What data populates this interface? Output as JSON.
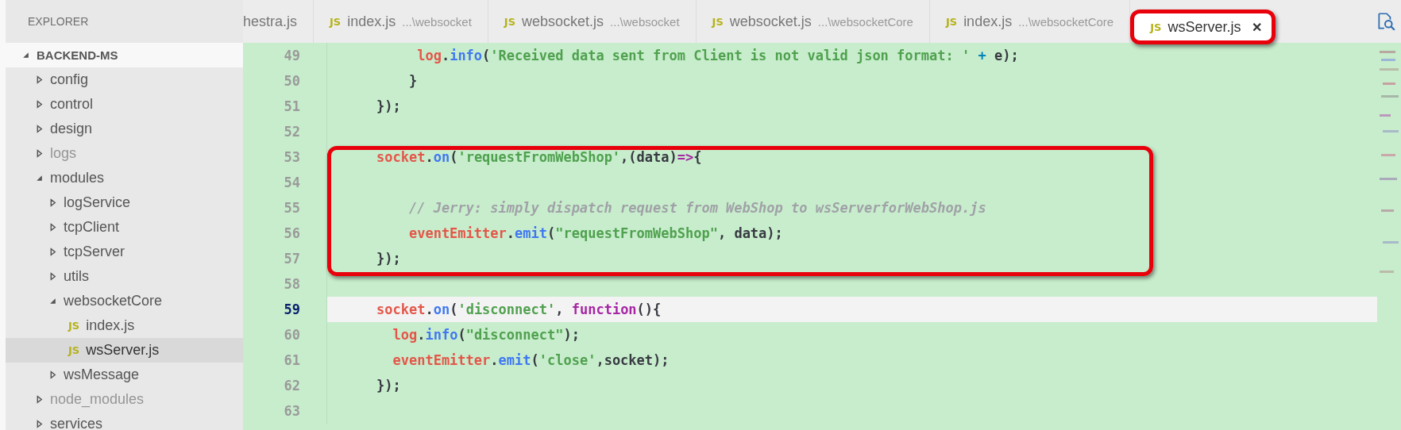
{
  "sidebar": {
    "title": "EXPLORER",
    "tree": [
      {
        "label": "BACKEND-MS",
        "kind": "root",
        "expanded": true,
        "children": [
          {
            "label": "config",
            "kind": "folder",
            "expanded": false,
            "dimmed": false
          },
          {
            "label": "control",
            "kind": "folder",
            "expanded": false,
            "dimmed": false
          },
          {
            "label": "design",
            "kind": "folder",
            "expanded": false,
            "dimmed": false
          },
          {
            "label": "logs",
            "kind": "folder",
            "expanded": false,
            "dimmed": true
          },
          {
            "label": "modules",
            "kind": "folder",
            "expanded": true,
            "dimmed": false,
            "children": [
              {
                "label": "logService",
                "kind": "folder",
                "expanded": false,
                "dimmed": false
              },
              {
                "label": "tcpClient",
                "kind": "folder",
                "expanded": false,
                "dimmed": false
              },
              {
                "label": "tcpServer",
                "kind": "folder",
                "expanded": false,
                "dimmed": false
              },
              {
                "label": "utils",
                "kind": "folder",
                "expanded": false,
                "dimmed": false
              },
              {
                "label": "websocketCore",
                "kind": "folder",
                "expanded": true,
                "dimmed": false,
                "children": [
                  {
                    "label": "index.js",
                    "kind": "file",
                    "badge": "JS",
                    "selected": false
                  },
                  {
                    "label": "wsServer.js",
                    "kind": "file",
                    "badge": "JS",
                    "selected": true
                  }
                ]
              },
              {
                "label": "wsMessage",
                "kind": "folder",
                "expanded": false,
                "dimmed": false
              }
            ]
          },
          {
            "label": "node_modules",
            "kind": "folder",
            "expanded": false,
            "dimmed": true
          },
          {
            "label": "services",
            "kind": "folder",
            "expanded": false,
            "dimmed": false
          }
        ]
      }
    ]
  },
  "tabs": [
    {
      "label": "hestra.js",
      "selected": false,
      "highlighted": false
    },
    {
      "badge": "JS",
      "label": "index.js",
      "path": "...\\websocket",
      "selected": false,
      "highlighted": false
    },
    {
      "badge": "JS",
      "label": "websocket.js",
      "path": "...\\websocket",
      "selected": false,
      "highlighted": false
    },
    {
      "badge": "JS",
      "label": "websocket.js",
      "path": "...\\websocketCore",
      "selected": false,
      "highlighted": false
    },
    {
      "badge": "JS",
      "label": "index.js",
      "path": "...\\websocketCore",
      "selected": false,
      "highlighted": false
    },
    {
      "badge": "JS",
      "label": "wsServer.js",
      "selected": true,
      "highlighted": true,
      "close": "✕"
    }
  ],
  "editor": {
    "blocks": [
      {
        "highlighted": false,
        "lines": [
          {
            "number": "49",
            "current": false,
            "tokens": [
              {
                "kind": "obj",
                "text": "     log"
              },
              {
                "kind": "plain",
                "text": "."
              },
              {
                "kind": "fn",
                "text": "info"
              },
              {
                "kind": "plain",
                "text": "("
              },
              {
                "kind": "str",
                "text": "'Received data sent from Client is not valid json format: '"
              },
              {
                "kind": "op",
                "text": " + "
              },
              {
                "kind": "plain",
                "text": "e);"
              }
            ]
          },
          {
            "number": "50",
            "current": false,
            "tokens": [
              {
                "kind": "plain",
                "text": "    }"
              }
            ]
          },
          {
            "number": "51",
            "current": false,
            "tokens": [
              {
                "kind": "plain",
                "text": "});"
              }
            ]
          },
          {
            "number": "52",
            "current": false
          }
        ]
      },
      {
        "highlighted": true,
        "lines": [
          {
            "number": "53",
            "current": false,
            "tokens": [
              {
                "kind": "obj",
                "text": "socket"
              },
              {
                "kind": "plain",
                "text": "."
              },
              {
                "kind": "fn",
                "text": "on"
              },
              {
                "kind": "plain",
                "text": "("
              },
              {
                "kind": "str",
                "text": "'requestFromWebShop'"
              },
              {
                "kind": "plain",
                "text": ",(data)"
              },
              {
                "kind": "kw",
                "text": "=>"
              },
              {
                "kind": "plain",
                "text": "{"
              }
            ]
          },
          {
            "number": "54",
            "current": false
          },
          {
            "number": "55",
            "current": false,
            "tokens": [
              {
                "kind": "comment",
                "text": "    // Jerry: simply dispatch request from WebShop to wsServerforWebShop.js"
              }
            ]
          },
          {
            "number": "56",
            "current": false,
            "tokens": [
              {
                "kind": "obj",
                "text": "    eventEmitter"
              },
              {
                "kind": "plain",
                "text": "."
              },
              {
                "kind": "fn",
                "text": "emit"
              },
              {
                "kind": "plain",
                "text": "("
              },
              {
                "kind": "str",
                "text": "\"requestFromWebShop\""
              },
              {
                "kind": "plain",
                "text": ", data);"
              }
            ]
          },
          {
            "number": "57",
            "current": false,
            "tokens": [
              {
                "kind": "plain",
                "text": "});"
              }
            ]
          }
        ]
      },
      {
        "highlighted": false,
        "lines": [
          {
            "number": "58",
            "current": false
          },
          {
            "number": "59",
            "current": true,
            "tokens": [
              {
                "kind": "obj",
                "text": "socket"
              },
              {
                "kind": "plain",
                "text": "."
              },
              {
                "kind": "fn",
                "text": "on"
              },
              {
                "kind": "plain",
                "text": "("
              },
              {
                "kind": "str",
                "text": "'disconnect'"
              },
              {
                "kind": "plain",
                "text": ", "
              },
              {
                "kind": "kw",
                "text": "function"
              },
              {
                "kind": "plain",
                "text": "(){"
              }
            ]
          },
          {
            "number": "60",
            "current": false,
            "tokens": [
              {
                "kind": "obj",
                "text": "  log"
              },
              {
                "kind": "plain",
                "text": "."
              },
              {
                "kind": "fn",
                "text": "info"
              },
              {
                "kind": "plain",
                "text": "("
              },
              {
                "kind": "str",
                "text": "\"disconnect\""
              },
              {
                "kind": "plain",
                "text": ");"
              }
            ]
          },
          {
            "number": "61",
            "current": false,
            "tokens": [
              {
                "kind": "obj",
                "text": "  eventEmitter"
              },
              {
                "kind": "plain",
                "text": "."
              },
              {
                "kind": "fn",
                "text": "emit"
              },
              {
                "kind": "plain",
                "text": "("
              },
              {
                "kind": "str",
                "text": "'close'"
              },
              {
                "kind": "plain",
                "text": ",socket);"
              }
            ]
          },
          {
            "number": "62",
            "current": false,
            "tokens": [
              {
                "kind": "plain",
                "text": "});"
              }
            ]
          },
          {
            "number": "63",
            "current": false
          }
        ]
      }
    ]
  }
}
